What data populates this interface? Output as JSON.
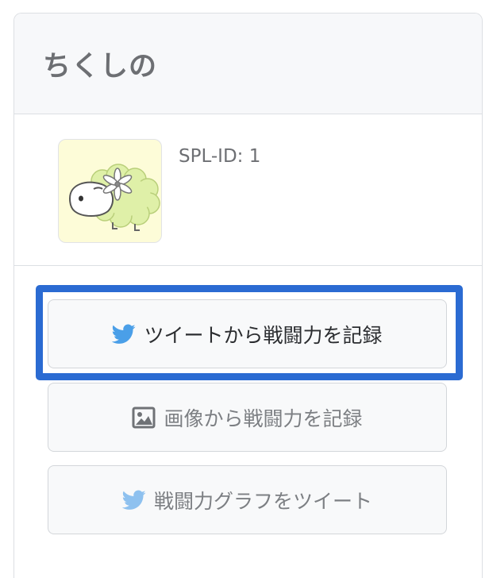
{
  "card": {
    "title": "ちくしの"
  },
  "profile": {
    "avatar_icon": "sheep-avatar-icon",
    "spl_id": "SPL-ID: 1"
  },
  "actions": {
    "record_from_tweet": {
      "label": "ツイートから戦闘力を記録",
      "icon": "twitter-bird-icon"
    },
    "record_from_image": {
      "label": "画像から戦闘力を記録",
      "icon": "image-icon"
    },
    "tweet_graph": {
      "label": "戦闘力グラフをツイート",
      "icon": "twitter-bird-icon"
    }
  },
  "colors": {
    "highlight": "#2b6bd2",
    "twitter": "#4a9fe8"
  }
}
